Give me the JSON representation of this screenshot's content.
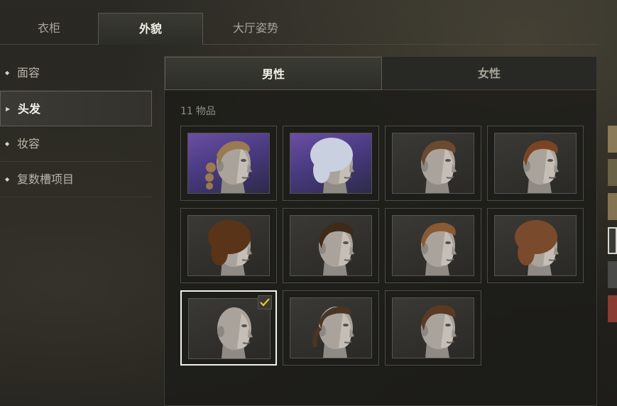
{
  "top_tabs": [
    "衣柜",
    "外貌",
    "大厅姿势"
  ],
  "side_menu": [
    "面容",
    "头发",
    "妆容",
    "复数槽项目"
  ],
  "gender_tabs": {
    "male": "男性",
    "female": "女性"
  },
  "item_count": {
    "number": "11",
    "label": "物品"
  },
  "items": [
    {
      "name": "hair-1",
      "style": "ponytail-braids",
      "background": "purple"
    },
    {
      "name": "hair-2",
      "style": "silver-bob",
      "background": "purple"
    },
    {
      "name": "hair-3",
      "style": "short-slick",
      "background": "dark"
    },
    {
      "name": "hair-4",
      "style": "side-part-auburn",
      "background": "dark"
    },
    {
      "name": "hair-5",
      "style": "curly-afro",
      "background": "dark"
    },
    {
      "name": "hair-6",
      "style": "short-curly",
      "background": "dark"
    },
    {
      "name": "hair-7",
      "style": "undercut",
      "background": "dark"
    },
    {
      "name": "hair-8",
      "style": "wavy-medium",
      "background": "dark"
    },
    {
      "name": "hair-9",
      "style": "bald",
      "background": "dark",
      "selected": true
    },
    {
      "name": "hair-10",
      "style": "slicked-ponytail",
      "background": "dark"
    },
    {
      "name": "hair-11",
      "style": "brown-short",
      "background": "dark"
    }
  ],
  "colors": {
    "swatches": [
      "#8a7a55",
      "#6a6246",
      "#847450",
      "#3a3a38",
      "#4a4a48",
      "#8a3a30"
    ],
    "selected_border": "#f2f2ec",
    "check": "#e0c838"
  }
}
